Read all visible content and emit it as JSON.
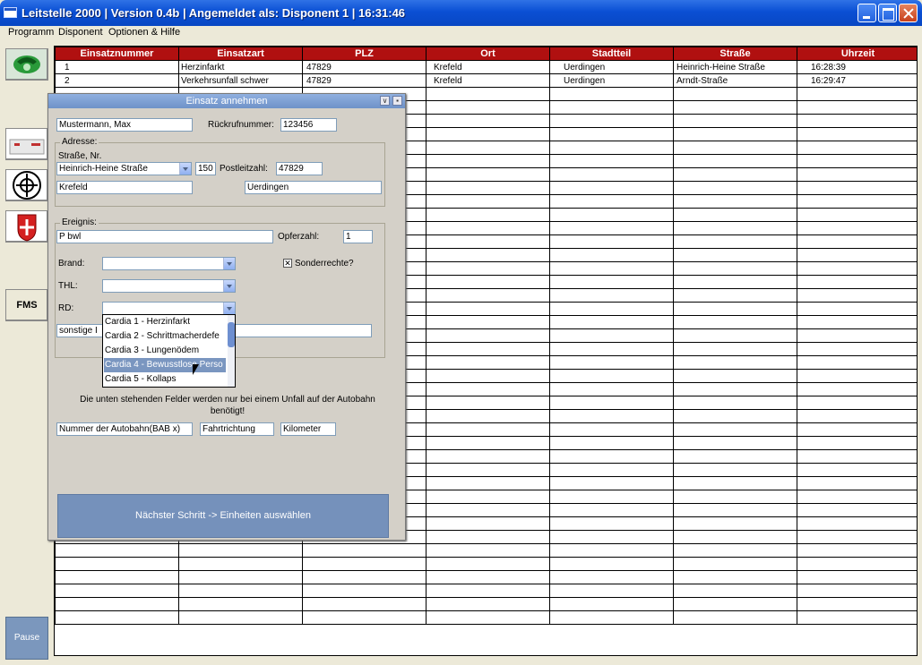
{
  "window": {
    "title": "Leitstelle 2000 | Version 0.4b | Angemeldet als: Disponent 1 |  16:31:46"
  },
  "menu": {
    "items": [
      "Programm",
      "Disponent",
      "Optionen & Hilfe"
    ]
  },
  "sidebar": {
    "icons": [
      "telephone-icon",
      "printer-icon",
      "fire-brigade-emblem-icon",
      "johanniter-cross-icon"
    ],
    "fms_label": "FMS",
    "pause_label": "Pause"
  },
  "table": {
    "headers": [
      "Einsatznummer",
      "Einsatzart",
      "PLZ",
      "Ort",
      "Stadtteil",
      "Straße",
      "Uhrzeit"
    ],
    "rows": [
      [
        "1",
        "Herzinfarkt",
        "47829",
        "Krefeld",
        "Uerdingen",
        "Heinrich-Heine Straße",
        "16:28:39"
      ],
      [
        "2",
        "Verkehrsunfall schwer",
        "47829",
        "Krefeld",
        "Uerdingen",
        "Arndt-Straße",
        "16:29:47"
      ]
    ]
  },
  "dialog": {
    "title": "Einsatz annehmen",
    "caller_name": "Mustermann, Max",
    "callback_label": "Rückrufnummer:",
    "callback_value": "123456",
    "address": {
      "group_label": "Adresse:",
      "street_label": "Straße, Nr.",
      "street_value": "Heinrich-Heine Straße",
      "number_value": "150",
      "zip_label": "Postleitzahl:",
      "zip_value": "47829",
      "city_value": "Krefeld",
      "district_value": "Uerdingen"
    },
    "event": {
      "group_label": "Ereignis:",
      "event_value": "P bwl",
      "victims_label": "Opferzahl:",
      "victims_value": "1",
      "brand_label": "Brand:",
      "thl_label": "THL:",
      "rd_label": "RD:",
      "special_rights_label": "Sonderrechte?",
      "special_rights_checked": true,
      "other_value": "sonstige I",
      "rd_options": [
        "Cardia 1 - Herzinfarkt",
        "Cardia 2 - Schrittmacherdefe",
        "Cardia 3 - Lungenödem",
        "Cardia 4 - Bewusstlose Perso",
        "Cardia 5 - Kollaps"
      ],
      "rd_selected_index": 3
    },
    "note_line1": "Die unten stehenden Felder werden nur bei einem Unfall auf der Autobahn",
    "note_line2": "benötigt!",
    "autobahn_placeholder": "Nummer der Autobahn(BAB x)",
    "direction_placeholder": "Fahrtrichtung",
    "km_placeholder": "Kilometer",
    "next_button": "Nächster Schritt -> Einheiten auswählen"
  },
  "colors": {
    "header_red": "#b01010",
    "xp_blue": "#0a4fd4",
    "button_blue": "#7591bb"
  }
}
